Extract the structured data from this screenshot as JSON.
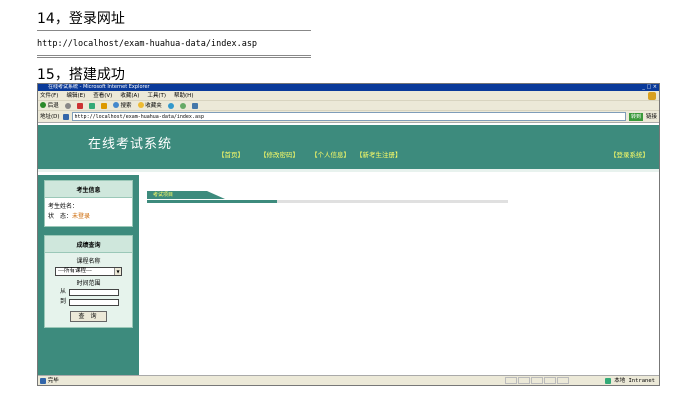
{
  "step14": {
    "title": "14，登录网址",
    "url": "http://localhost/exam-huahua-data/index.asp"
  },
  "step15": {
    "title": "15，搭建成功"
  },
  "browser": {
    "window_title": "在线考试系统 - Microsoft Internet Explorer",
    "window_controls": "_ □ ×",
    "menu": [
      "文件(F)",
      "编辑(E)",
      "查看(V)",
      "收藏(A)",
      "工具(T)",
      "帮助(H)"
    ],
    "toolbar": {
      "back": "后退",
      "search": "搜索",
      "favorites": "收藏夹"
    },
    "address_label": "地址(D)",
    "address": "http://localhost/exam-huahua-data/index.asp",
    "go_label": "转到",
    "links_label": "链接",
    "status_text": "完毕",
    "zone_text": "本地 Intranet"
  },
  "site": {
    "title": "在线考试系统",
    "nav": [
      "【首页】",
      "【修改密码】",
      "【个人信息】",
      "【新考生注册】"
    ],
    "login": "【登录系统】"
  },
  "sidebar": {
    "info_head": "考生信息",
    "name_label": "考生姓名：",
    "status_label": "状　态：",
    "status_value": "未登录",
    "query_head": "成绩查询",
    "course_label": "课程名称",
    "course_select": "---所有课程---",
    "range_label": "时间范围",
    "from_label": "从",
    "to_label": "到",
    "query_button": "查 询"
  },
  "main": {
    "tab_label": "考试项目",
    "tab_progress": 0.36
  },
  "colors": {
    "brand": "#3d8b7d",
    "nav_text": "#ffff66",
    "panel": "#cfe7dc"
  }
}
